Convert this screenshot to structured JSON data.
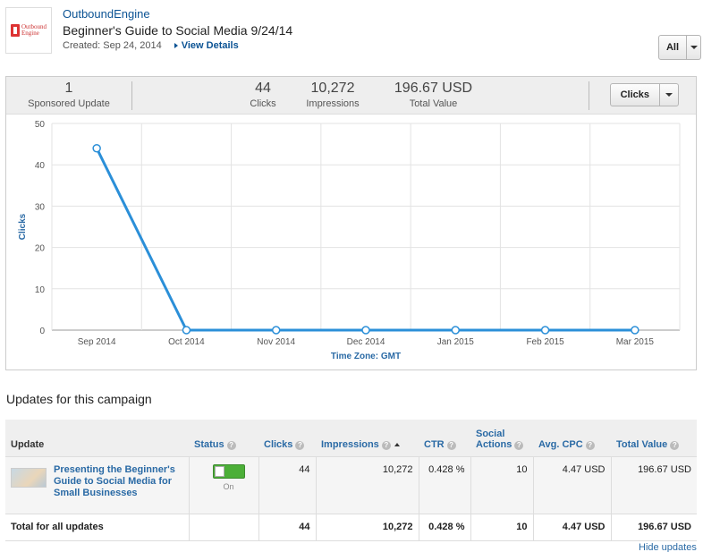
{
  "header": {
    "logo_text_line1": "Outbound",
    "logo_text_line2": "Engine",
    "company": "OutboundEngine",
    "campaign_title": "Beginner's Guide to Social Media 9/24/14",
    "created": "Created: Sep 24, 2014",
    "view_details": "View Details",
    "filter_label": "All"
  },
  "stats": {
    "sponsored_count": "1",
    "sponsored_label": "Sponsored Update",
    "clicks_value": "44",
    "clicks_label": "Clicks",
    "impressions_value": "10,272",
    "impressions_label": "Impressions",
    "total_value": "196.67 USD",
    "total_label": "Total Value",
    "metric_dropdown": "Clicks"
  },
  "chart_data": {
    "type": "line",
    "ylabel": "Clicks",
    "xlabel": "Time Zone: GMT",
    "categories": [
      "Sep 2014",
      "Oct 2014",
      "Nov 2014",
      "Dec 2014",
      "Jan 2015",
      "Feb 2015",
      "Mar 2015"
    ],
    "series": [
      {
        "values": [
          44,
          0,
          0,
          0,
          0,
          0,
          0
        ]
      }
    ],
    "ylim": [
      0,
      50
    ],
    "yticks": [
      0,
      10,
      20,
      30,
      40,
      50
    ],
    "grid": true,
    "color": "#2b8fd8"
  },
  "updates": {
    "title": "Updates for this campaign",
    "columns": {
      "update": "Update",
      "status": "Status",
      "clicks": "Clicks",
      "impressions": "Impressions",
      "ctr": "CTR",
      "social_actions_line1": "Social",
      "social_actions_line2": "Actions",
      "avg_cpc": "Avg. CPC",
      "total_value": "Total Value"
    },
    "help_glyph": "?",
    "rows": [
      {
        "title": "Presenting the Beginner's Guide to Social Media for Small Businesses",
        "status": "On",
        "clicks": "44",
        "impressions": "10,272",
        "ctr": "0.428 %",
        "social_actions": "10",
        "avg_cpc": "4.47 USD",
        "total_value": "196.67 USD"
      }
    ],
    "total": {
      "label": "Total for all updates",
      "clicks": "44",
      "impressions": "10,272",
      "ctr": "0.428 %",
      "social_actions": "10",
      "avg_cpc": "4.47 USD",
      "total_value": "196.67 USD"
    },
    "hide_updates": "Hide updates »"
  }
}
